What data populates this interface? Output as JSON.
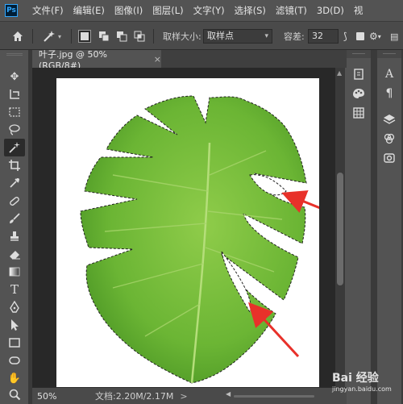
{
  "app": {
    "logo_text": "Ps",
    "menus": [
      "文件(F)",
      "编辑(E)",
      "图像(I)",
      "图层(L)",
      "文字(Y)",
      "选择(S)",
      "滤镜(T)",
      "3D(D)",
      "视"
    ]
  },
  "options": {
    "home_icon": "home-icon",
    "tool_icon": "magic-wand-icon",
    "sample_size_label": "取样大小:",
    "sample_size_value": "取样点",
    "tolerance_label": "容差:",
    "tolerance_value": "32"
  },
  "document": {
    "tab_title": "叶子.jpg @ 50%(RGB/8#)",
    "tab_close": "×"
  },
  "status": {
    "zoom": "50%",
    "doc_info": "文档:2.20M/2.17M",
    "arrow": ">"
  },
  "tools": [
    "move-icon",
    "artboard-icon",
    "marquee-icon",
    "lasso-icon",
    "magic-wand-icon",
    "crop-icon",
    "eyedropper-icon",
    "healing-brush-icon",
    "brush-icon",
    "stamp-icon",
    "history-brush-icon",
    "eraser-icon",
    "gradient-icon",
    "blur-icon",
    "dodge-icon",
    "pen-icon",
    "type-icon",
    "path-selection-icon",
    "rectangle-icon",
    "hand-icon",
    "zoom-icon"
  ],
  "right_panels": {
    "col1": [
      "history-icon",
      "color-icon",
      "swatches-icon"
    ],
    "col2": [
      "character-icon",
      "paragraph-icon",
      "layers-icon",
      "channels-icon",
      "cc-libraries-icon"
    ]
  },
  "watermark": {
    "text": "Bai 经验",
    "sub": "jingyan.baidu.com"
  },
  "colors": {
    "leaf_light": "#8cc63f",
    "leaf_dark": "#3f8a1f",
    "arrow_red": "#e8312a"
  }
}
